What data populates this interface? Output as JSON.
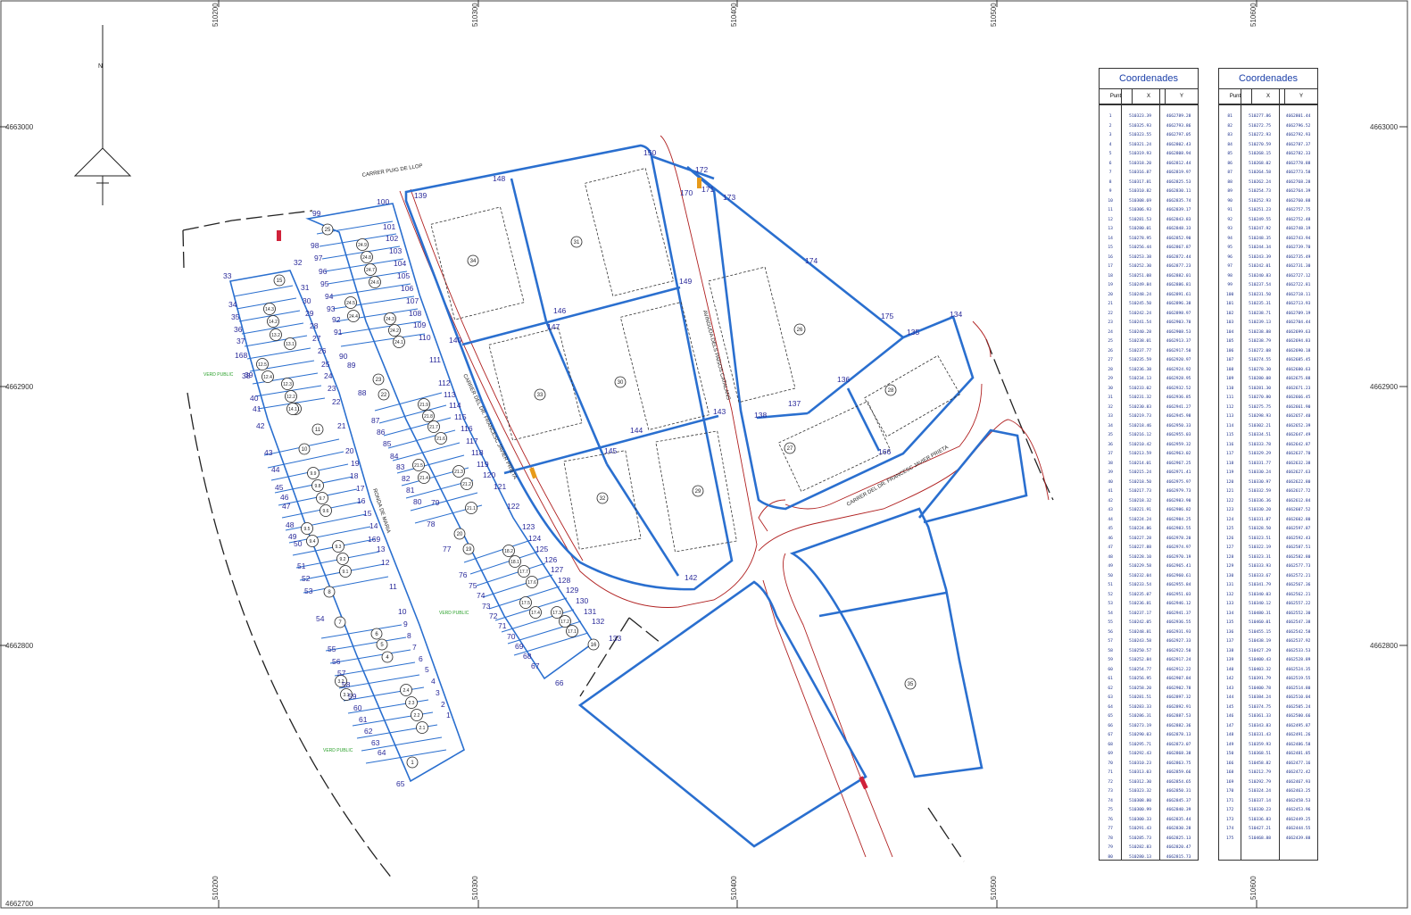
{
  "grid": {
    "x_labels": [
      "510200",
      "510300",
      "510400",
      "510500",
      "510600"
    ],
    "y_labels": [
      "4663000",
      "4662900",
      "4662800",
      "4662700"
    ]
  },
  "north_label": "N",
  "streets": {
    "puig": "CARRER PUIG DE LLOP",
    "francesc": "CARRER DEL DR. FRANCESC JAVIER PRIETA",
    "francesc2": "CARRER DEL DR. FRANCESC JAVIER PRIETA",
    "paisos": "AVINGUDA DELS PAÏSOS CATALANS",
    "ronda": "RONDA DE MARIA"
  },
  "verd_labels": [
    "VERD PUBLIC",
    "VERD PUBLIC",
    "VERD PUBLIC"
  ],
  "circles": [
    "1",
    "2.1",
    "2.2",
    "2.3",
    "2.4",
    "3.1",
    "3.2",
    "4",
    "5",
    "6",
    "7",
    "8",
    "9.1",
    "9.2",
    "9.3",
    "9.4",
    "9.5",
    "9.6",
    "9.7",
    "9.8",
    "9.9",
    "10",
    "11",
    "12.1",
    "12.2",
    "12.3",
    "12.4",
    "12.5",
    "13.1",
    "13.2",
    "14.1",
    "14.2",
    "14.3",
    "15",
    "16",
    "17.1",
    "17.2",
    "17.3",
    "17.4",
    "17.5",
    "17.6",
    "17.7",
    "18.1",
    "18.2",
    "19",
    "20",
    "21.1",
    "21.2",
    "21.3",
    "21.4",
    "21.5",
    "21.6",
    "21.7",
    "21.8",
    "21.9",
    "22",
    "23",
    "24.1",
    "24.2",
    "24.3",
    "24.4",
    "24.5",
    "24.6",
    "24.7",
    "24.8",
    "24.9",
    "25",
    "26",
    "27",
    "28",
    "29",
    "30",
    "31",
    "32",
    "33",
    "34",
    "35"
  ],
  "points": [
    "1",
    "2",
    "3",
    "4",
    "5",
    "6",
    "7",
    "8",
    "9",
    "10",
    "11",
    "12",
    "13",
    "14",
    "15",
    "16",
    "17",
    "18",
    "19",
    "20",
    "21",
    "22",
    "23",
    "24",
    "25",
    "26",
    "27",
    "28",
    "29",
    "30",
    "31",
    "32",
    "33",
    "34",
    "35",
    "36",
    "37",
    "38",
    "39",
    "40",
    "41",
    "42",
    "43",
    "44",
    "45",
    "46",
    "47",
    "48",
    "49",
    "50",
    "51",
    "52",
    "53",
    "54",
    "55",
    "56",
    "57",
    "58",
    "59",
    "60",
    "61",
    "62",
    "63",
    "64",
    "65",
    "66",
    "67",
    "68",
    "69",
    "70",
    "71",
    "72",
    "73",
    "74",
    "75",
    "76",
    "77",
    "78",
    "79",
    "80",
    "81",
    "82",
    "83",
    "84",
    "85",
    "86",
    "87",
    "88",
    "89",
    "90",
    "91",
    "92",
    "93",
    "94",
    "95",
    "96",
    "97",
    "98",
    "99",
    "100",
    "101",
    "102",
    "103",
    "104",
    "105",
    "106",
    "107",
    "108",
    "109",
    "110",
    "111",
    "112",
    "113",
    "114",
    "115",
    "116",
    "117",
    "118",
    "119",
    "120",
    "121",
    "122",
    "123",
    "124",
    "125",
    "126",
    "127",
    "128",
    "129",
    "130",
    "131",
    "132",
    "133",
    "134",
    "135",
    "136",
    "137",
    "138",
    "139",
    "140",
    "142",
    "143",
    "144",
    "145",
    "146",
    "147",
    "148",
    "149",
    "150",
    "166",
    "168",
    "169",
    "170",
    "171",
    "172",
    "173",
    "174",
    "175"
  ],
  "table1": {
    "title": "Coordenades",
    "headers": [
      "Punt",
      "X",
      "Y"
    ],
    "rows": [
      [
        "1",
        "510323.39",
        "4662789.28"
      ],
      [
        "2",
        "510325.93",
        "4662793.86"
      ],
      [
        "3",
        "510323.55",
        "4662797.05"
      ],
      [
        "4",
        "510321.24",
        "4662802.43"
      ],
      [
        "5",
        "510319.93",
        "4662808.94"
      ],
      [
        "6",
        "510318.20",
        "4662812.44"
      ],
      [
        "7",
        "510316.87",
        "4662819.97"
      ],
      [
        "8",
        "510317.81",
        "4662825.53"
      ],
      [
        "9",
        "510310.82",
        "4662830.11"
      ],
      [
        "10",
        "510308.69",
        "4662835.74"
      ],
      [
        "11",
        "510306.93",
        "4662839.17"
      ],
      [
        "12",
        "510281.53",
        "4662843.83"
      ],
      [
        "13",
        "510280.01",
        "4662848.33"
      ],
      [
        "14",
        "510278.95",
        "4662852.90"
      ],
      [
        "15",
        "510256.44",
        "4662867.87"
      ],
      [
        "16",
        "510253.38",
        "4662872.44"
      ],
      [
        "17",
        "510252.30",
        "4662877.23"
      ],
      [
        "18",
        "510251.08",
        "4662882.01"
      ],
      [
        "19",
        "510249.84",
        "4662886.81"
      ],
      [
        "20",
        "510248.24",
        "4662891.61"
      ],
      [
        "21",
        "510245.50",
        "4662896.38"
      ],
      [
        "22",
        "510242.24",
        "4662898.97"
      ],
      [
        "23",
        "510241.54",
        "4662903.70"
      ],
      [
        "24",
        "510240.28",
        "4662908.53"
      ],
      [
        "25",
        "510238.01",
        "4662913.37"
      ],
      [
        "26",
        "510237.77",
        "4662917.50"
      ],
      [
        "27",
        "510235.59",
        "4662920.97"
      ],
      [
        "28",
        "510236.38",
        "4662924.92"
      ],
      [
        "29",
        "510234.13",
        "4662928.95"
      ],
      [
        "30",
        "510233.02",
        "4662932.52"
      ],
      [
        "31",
        "510231.32",
        "4662936.85"
      ],
      [
        "32",
        "510230.83",
        "4662941.27"
      ],
      [
        "33",
        "510219.73",
        "4662945.98"
      ],
      [
        "34",
        "510218.46",
        "4662950.33"
      ],
      [
        "35",
        "510216.12",
        "4662955.03"
      ],
      [
        "36",
        "510210.42",
        "4662959.32"
      ],
      [
        "37",
        "510213.59",
        "4662963.02"
      ],
      [
        "38",
        "510214.01",
        "4662967.25"
      ],
      [
        "39",
        "510215.24",
        "4662971.41"
      ],
      [
        "40",
        "510218.50",
        "4662975.97"
      ],
      [
        "41",
        "510217.73",
        "4662979.73"
      ],
      [
        "42",
        "510218.32",
        "4662983.90"
      ],
      [
        "43",
        "510221.91",
        "4662986.82"
      ],
      [
        "44",
        "510224.24",
        "4662984.25"
      ],
      [
        "45",
        "510224.86",
        "4662983.55"
      ],
      [
        "46",
        "510227.28",
        "4662978.20"
      ],
      [
        "47",
        "510227.88",
        "4662974.97"
      ],
      [
        "48",
        "510228.10",
        "4662970.19"
      ],
      [
        "49",
        "510229.58",
        "4662965.41"
      ],
      [
        "50",
        "510232.04",
        "4662960.61"
      ],
      [
        "51",
        "510233.54",
        "4662955.84"
      ],
      [
        "52",
        "510235.07",
        "4662951.03"
      ],
      [
        "53",
        "510236.81",
        "4662946.12"
      ],
      [
        "54",
        "510237.17",
        "4662941.37"
      ],
      [
        "55",
        "510242.05",
        "4662936.55"
      ],
      [
        "56",
        "510248.81",
        "4662931.93"
      ],
      [
        "57",
        "510243.58",
        "4662927.33"
      ],
      [
        "58",
        "510250.57",
        "4662922.50"
      ],
      [
        "59",
        "510252.84",
        "4662917.24"
      ],
      [
        "60",
        "510254.77",
        "4662912.22"
      ],
      [
        "61",
        "510256.95",
        "4662907.84"
      ],
      [
        "62",
        "510258.20",
        "4662902.78"
      ],
      [
        "63",
        "510281.51",
        "4662897.32"
      ],
      [
        "64",
        "510283.33",
        "4662892.91"
      ],
      [
        "65",
        "510286.31",
        "4662887.53"
      ],
      [
        "66",
        "510273.19",
        "4662882.36"
      ],
      [
        "67",
        "510290.03",
        "4662878.13"
      ],
      [
        "68",
        "510295.71",
        "4662873.07"
      ],
      [
        "69",
        "510292.43",
        "4662868.38"
      ],
      [
        "70",
        "510310.23",
        "4662863.75"
      ],
      [
        "71",
        "510313.03",
        "4662859.66"
      ],
      [
        "72",
        "510312.30",
        "4662854.65"
      ],
      [
        "73",
        "510323.32",
        "4662850.31"
      ],
      [
        "74",
        "510308.80",
        "4662845.37"
      ],
      [
        "75",
        "510300.99",
        "4662840.39"
      ],
      [
        "76",
        "510300.33",
        "4662835.44"
      ],
      [
        "77",
        "510291.43",
        "4662830.28"
      ],
      [
        "78",
        "510285.73",
        "4662825.13"
      ],
      [
        "79",
        "510282.83",
        "4662820.47"
      ],
      [
        "80",
        "510280.13",
        "4662815.73"
      ]
    ]
  },
  "table2": {
    "title": "Coordenades",
    "headers": [
      "Punt",
      "X",
      "Y"
    ],
    "rows": [
      [
        "81",
        "510277.86",
        "4662801.44"
      ],
      [
        "82",
        "510272.75",
        "4662796.52"
      ],
      [
        "83",
        "510272.93",
        "4662792.93"
      ],
      [
        "84",
        "510270.59",
        "4662787.37"
      ],
      [
        "85",
        "510268.15",
        "4662782.33"
      ],
      [
        "86",
        "510268.02",
        "4662778.88"
      ],
      [
        "87",
        "510264.58",
        "4662773.58"
      ],
      [
        "88",
        "510262.24",
        "4662768.28"
      ],
      [
        "89",
        "510254.73",
        "4662764.39"
      ],
      [
        "90",
        "510252.93",
        "4662760.88"
      ],
      [
        "91",
        "510251.23",
        "4662757.75"
      ],
      [
        "92",
        "510249.55",
        "4662752.48"
      ],
      [
        "93",
        "510247.92",
        "4662748.19"
      ],
      [
        "94",
        "510248.35",
        "4662743.94"
      ],
      [
        "95",
        "510244.34",
        "4662739.70"
      ],
      [
        "96",
        "510243.39",
        "4662735.49"
      ],
      [
        "97",
        "510242.01",
        "4662731.30"
      ],
      [
        "98",
        "510240.83",
        "4662727.12"
      ],
      [
        "99",
        "510237.54",
        "4662722.81"
      ],
      [
        "100",
        "510231.50",
        "4662718.11"
      ],
      [
        "101",
        "510235.31",
        "4662713.93"
      ],
      [
        "102",
        "510238.71",
        "4662709.19"
      ],
      [
        "103",
        "510239.13",
        "4662704.44"
      ],
      [
        "104",
        "510238.88",
        "4662699.63"
      ],
      [
        "105",
        "510238.79",
        "4662694.83"
      ],
      [
        "106",
        "510272.08",
        "4662690.18"
      ],
      [
        "107",
        "510274.55",
        "4662685.45"
      ],
      [
        "108",
        "510278.30",
        "4662680.63"
      ],
      [
        "109",
        "510280.08",
        "4662675.88"
      ],
      [
        "110",
        "510281.30",
        "4662671.23"
      ],
      [
        "111",
        "510270.80",
        "4662666.45"
      ],
      [
        "112",
        "510275.75",
        "4662661.90"
      ],
      [
        "113",
        "510298.93",
        "4662657.40"
      ],
      [
        "114",
        "510302.21",
        "4662652.39"
      ],
      [
        "115",
        "510334.51",
        "4662647.49"
      ],
      [
        "116",
        "510333.78",
        "4662642.87"
      ],
      [
        "117",
        "510329.29",
        "4662637.70"
      ],
      [
        "118",
        "510331.77",
        "4662632.38"
      ],
      [
        "119",
        "510330.24",
        "4662627.63"
      ],
      [
        "120",
        "510330.97",
        "4662622.80"
      ],
      [
        "121",
        "510332.59",
        "4662617.72"
      ],
      [
        "122",
        "510336.36",
        "4662612.84"
      ],
      [
        "123",
        "510330.20",
        "4662607.52"
      ],
      [
        "124",
        "510331.87",
        "4662602.80"
      ],
      [
        "125",
        "510328.50",
        "4662597.87"
      ],
      [
        "126",
        "510323.51",
        "4662592.43"
      ],
      [
        "127",
        "510322.19",
        "4662587.51"
      ],
      [
        "128",
        "510323.31",
        "4662582.80"
      ],
      [
        "129",
        "510333.93",
        "4662577.73"
      ],
      [
        "130",
        "510333.67",
        "4662572.21"
      ],
      [
        "131",
        "510341.79",
        "4662567.36"
      ],
      [
        "132",
        "510340.03",
        "4662562.21"
      ],
      [
        "133",
        "510340.12",
        "4662557.22"
      ],
      [
        "134",
        "510480.31",
        "4662552.30"
      ],
      [
        "135",
        "510460.01",
        "4662547.38"
      ],
      [
        "136",
        "510455.15",
        "4662542.58"
      ],
      [
        "137",
        "510438.19",
        "4662537.92"
      ],
      [
        "138",
        "510427.29",
        "4662533.53"
      ],
      [
        "139",
        "510400.43",
        "4662528.89"
      ],
      [
        "140",
        "510403.32",
        "4662524.35"
      ],
      [
        "142",
        "510391.79",
        "4662519.55"
      ],
      [
        "143",
        "510400.78",
        "4662514.80"
      ],
      [
        "144",
        "510384.24",
        "4662510.04"
      ],
      [
        "145",
        "510374.75",
        "4662505.24"
      ],
      [
        "146",
        "510361.33",
        "4662500.66"
      ],
      [
        "147",
        "510343.83",
        "4662495.87"
      ],
      [
        "148",
        "510331.43",
        "4662491.26"
      ],
      [
        "149",
        "510359.93",
        "4662486.58"
      ],
      [
        "150",
        "510368.51",
        "4662481.85"
      ],
      [
        "166",
        "510458.82",
        "4662477.16"
      ],
      [
        "168",
        "510212.79",
        "4662472.42"
      ],
      [
        "169",
        "510292.79",
        "4662467.93"
      ],
      [
        "170",
        "510324.24",
        "4662463.25"
      ],
      [
        "171",
        "510337.14",
        "4662458.53"
      ],
      [
        "172",
        "510330.23",
        "4662453.96"
      ],
      [
        "173",
        "510336.83",
        "4662449.25"
      ],
      [
        "174",
        "510427.21",
        "4662444.55"
      ],
      [
        "175",
        "510468.88",
        "4662439.88"
      ]
    ]
  }
}
